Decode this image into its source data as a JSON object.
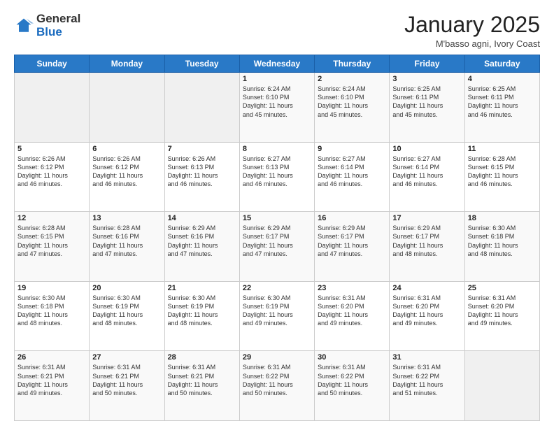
{
  "logo": {
    "general": "General",
    "blue": "Blue"
  },
  "header": {
    "month": "January 2025",
    "location": "M'basso agni, Ivory Coast"
  },
  "days_of_week": [
    "Sunday",
    "Monday",
    "Tuesday",
    "Wednesday",
    "Thursday",
    "Friday",
    "Saturday"
  ],
  "weeks": [
    [
      {
        "day": "",
        "detail": ""
      },
      {
        "day": "",
        "detail": ""
      },
      {
        "day": "",
        "detail": ""
      },
      {
        "day": "1",
        "detail": "Sunrise: 6:24 AM\nSunset: 6:10 PM\nDaylight: 11 hours\nand 45 minutes."
      },
      {
        "day": "2",
        "detail": "Sunrise: 6:24 AM\nSunset: 6:10 PM\nDaylight: 11 hours\nand 45 minutes."
      },
      {
        "day": "3",
        "detail": "Sunrise: 6:25 AM\nSunset: 6:11 PM\nDaylight: 11 hours\nand 45 minutes."
      },
      {
        "day": "4",
        "detail": "Sunrise: 6:25 AM\nSunset: 6:11 PM\nDaylight: 11 hours\nand 46 minutes."
      }
    ],
    [
      {
        "day": "5",
        "detail": "Sunrise: 6:26 AM\nSunset: 6:12 PM\nDaylight: 11 hours\nand 46 minutes."
      },
      {
        "day": "6",
        "detail": "Sunrise: 6:26 AM\nSunset: 6:12 PM\nDaylight: 11 hours\nand 46 minutes."
      },
      {
        "day": "7",
        "detail": "Sunrise: 6:26 AM\nSunset: 6:13 PM\nDaylight: 11 hours\nand 46 minutes."
      },
      {
        "day": "8",
        "detail": "Sunrise: 6:27 AM\nSunset: 6:13 PM\nDaylight: 11 hours\nand 46 minutes."
      },
      {
        "day": "9",
        "detail": "Sunrise: 6:27 AM\nSunset: 6:14 PM\nDaylight: 11 hours\nand 46 minutes."
      },
      {
        "day": "10",
        "detail": "Sunrise: 6:27 AM\nSunset: 6:14 PM\nDaylight: 11 hours\nand 46 minutes."
      },
      {
        "day": "11",
        "detail": "Sunrise: 6:28 AM\nSunset: 6:15 PM\nDaylight: 11 hours\nand 46 minutes."
      }
    ],
    [
      {
        "day": "12",
        "detail": "Sunrise: 6:28 AM\nSunset: 6:15 PM\nDaylight: 11 hours\nand 47 minutes."
      },
      {
        "day": "13",
        "detail": "Sunrise: 6:28 AM\nSunset: 6:16 PM\nDaylight: 11 hours\nand 47 minutes."
      },
      {
        "day": "14",
        "detail": "Sunrise: 6:29 AM\nSunset: 6:16 PM\nDaylight: 11 hours\nand 47 minutes."
      },
      {
        "day": "15",
        "detail": "Sunrise: 6:29 AM\nSunset: 6:17 PM\nDaylight: 11 hours\nand 47 minutes."
      },
      {
        "day": "16",
        "detail": "Sunrise: 6:29 AM\nSunset: 6:17 PM\nDaylight: 11 hours\nand 47 minutes."
      },
      {
        "day": "17",
        "detail": "Sunrise: 6:29 AM\nSunset: 6:17 PM\nDaylight: 11 hours\nand 48 minutes."
      },
      {
        "day": "18",
        "detail": "Sunrise: 6:30 AM\nSunset: 6:18 PM\nDaylight: 11 hours\nand 48 minutes."
      }
    ],
    [
      {
        "day": "19",
        "detail": "Sunrise: 6:30 AM\nSunset: 6:18 PM\nDaylight: 11 hours\nand 48 minutes."
      },
      {
        "day": "20",
        "detail": "Sunrise: 6:30 AM\nSunset: 6:19 PM\nDaylight: 11 hours\nand 48 minutes."
      },
      {
        "day": "21",
        "detail": "Sunrise: 6:30 AM\nSunset: 6:19 PM\nDaylight: 11 hours\nand 48 minutes."
      },
      {
        "day": "22",
        "detail": "Sunrise: 6:30 AM\nSunset: 6:19 PM\nDaylight: 11 hours\nand 49 minutes."
      },
      {
        "day": "23",
        "detail": "Sunrise: 6:31 AM\nSunset: 6:20 PM\nDaylight: 11 hours\nand 49 minutes."
      },
      {
        "day": "24",
        "detail": "Sunrise: 6:31 AM\nSunset: 6:20 PM\nDaylight: 11 hours\nand 49 minutes."
      },
      {
        "day": "25",
        "detail": "Sunrise: 6:31 AM\nSunset: 6:20 PM\nDaylight: 11 hours\nand 49 minutes."
      }
    ],
    [
      {
        "day": "26",
        "detail": "Sunrise: 6:31 AM\nSunset: 6:21 PM\nDaylight: 11 hours\nand 49 minutes."
      },
      {
        "day": "27",
        "detail": "Sunrise: 6:31 AM\nSunset: 6:21 PM\nDaylight: 11 hours\nand 50 minutes."
      },
      {
        "day": "28",
        "detail": "Sunrise: 6:31 AM\nSunset: 6:21 PM\nDaylight: 11 hours\nand 50 minutes."
      },
      {
        "day": "29",
        "detail": "Sunrise: 6:31 AM\nSunset: 6:22 PM\nDaylight: 11 hours\nand 50 minutes."
      },
      {
        "day": "30",
        "detail": "Sunrise: 6:31 AM\nSunset: 6:22 PM\nDaylight: 11 hours\nand 50 minutes."
      },
      {
        "day": "31",
        "detail": "Sunrise: 6:31 AM\nSunset: 6:22 PM\nDaylight: 11 hours\nand 51 minutes."
      },
      {
        "day": "",
        "detail": ""
      }
    ]
  ]
}
